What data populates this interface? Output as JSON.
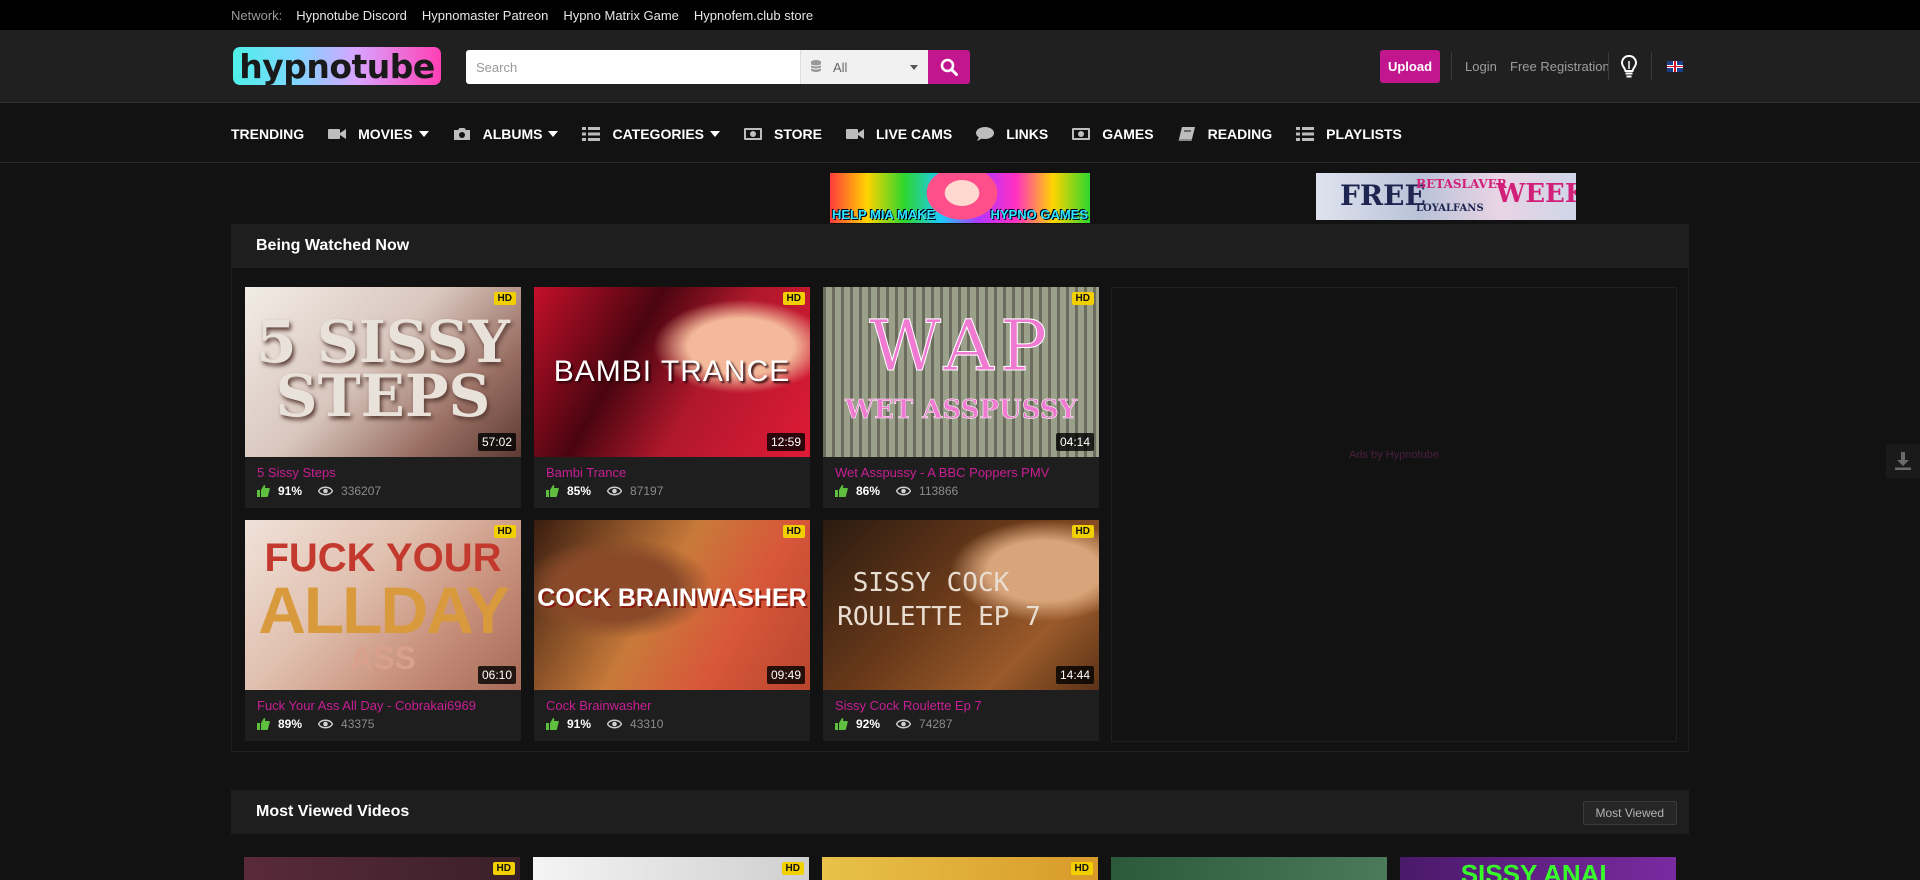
{
  "network": {
    "label": "Network:",
    "links": [
      "Hypnotube Discord",
      "Hypnomaster Patreon",
      "Hypno Matrix Game",
      "Hypnofem.club store"
    ]
  },
  "header": {
    "logo_text": "hypnotube",
    "search_placeholder": "Search",
    "search_category": "All",
    "upload_label": "Upload",
    "login_label": "Login",
    "register_label": "Free Registration"
  },
  "nav": [
    {
      "label": "TRENDING",
      "icon": "",
      "dropdown": false
    },
    {
      "label": "MOVIES",
      "icon": "video-camera-icon",
      "dropdown": true
    },
    {
      "label": "ALBUMS",
      "icon": "camera-icon",
      "dropdown": true
    },
    {
      "label": "CATEGORIES",
      "icon": "list-icon",
      "dropdown": true
    },
    {
      "label": "STORE",
      "icon": "money-icon",
      "dropdown": false
    },
    {
      "label": "LIVE CAMS",
      "icon": "video-camera-icon",
      "dropdown": false
    },
    {
      "label": "LINKS",
      "icon": "chat-bubble-icon",
      "dropdown": false
    },
    {
      "label": "GAMES",
      "icon": "money-icon",
      "dropdown": false
    },
    {
      "label": "READING",
      "icon": "book-icon",
      "dropdown": false
    },
    {
      "label": "PLAYLISTS",
      "icon": "list-icon",
      "dropdown": false
    }
  ],
  "banners": {
    "left_text_a": "HELP MIA MAKE",
    "left_text_b": "HYPNO GAMES",
    "right_text_a": "FREE",
    "right_text_b": "BETASLAVER",
    "right_text_c": "WEEK",
    "right_text_d": "LOYALFANS"
  },
  "being_watched": {
    "title": "Being Watched Now",
    "ad_text": "Ads by Hypnotube",
    "videos": [
      {
        "title": "5 Sissy Steps",
        "duration": "57:02",
        "rating": "91%",
        "views": "336207",
        "badge": "HD",
        "caption": "5 SISSY STEPS"
      },
      {
        "title": "Bambi Trance",
        "duration": "12:59",
        "rating": "85%",
        "views": "87197",
        "badge": "HD",
        "caption": "BAMBI TRANCE"
      },
      {
        "title": "Wet Asspussy - A BBC Poppers PMV",
        "duration": "04:14",
        "rating": "86%",
        "views": "113866",
        "badge": "HD",
        "caption": "WAP",
        "caption2": "WET ASSPUSSY"
      },
      {
        "title": "Fuck Your Ass All Day - Cobrakai6969",
        "duration": "06:10",
        "rating": "89%",
        "views": "43375",
        "badge": "HD",
        "caption": "FUCK YOUR",
        "caption2": "ALLDAY",
        "caption3": "ASS"
      },
      {
        "title": "Cock Brainwasher",
        "duration": "09:49",
        "rating": "91%",
        "views": "43310",
        "badge": "HD",
        "caption": "COCK BRAINWASHER"
      },
      {
        "title": "Sissy Cock Roulette Ep 7",
        "duration": "14:44",
        "rating": "92%",
        "views": "74287",
        "badge": "HD",
        "caption": "SISSY COCK",
        "caption2": "ROULETTE EP 7"
      }
    ]
  },
  "most_viewed": {
    "title": "Most Viewed Videos",
    "sort_label": "Most Viewed",
    "badge": "HD",
    "peek_caption": "SISSY ANAL"
  },
  "colors": {
    "accent": "#c2168f",
    "title_link": "#c81e95",
    "hd_badge": "#f2d000",
    "thumbs_up": "#5fbf3f"
  }
}
